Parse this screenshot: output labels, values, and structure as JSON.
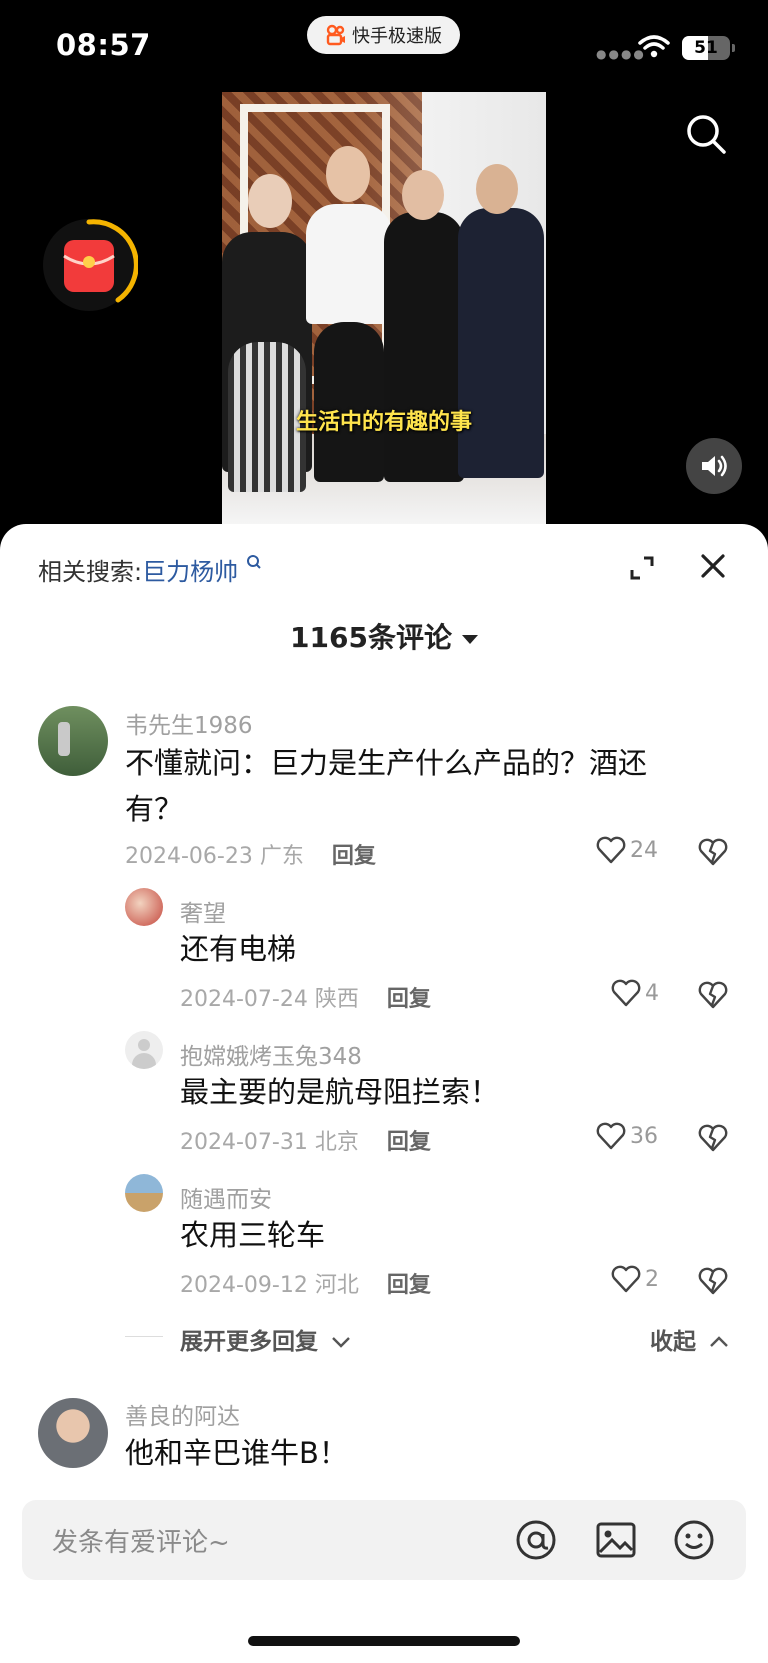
{
  "status_bar": {
    "time": "08:57",
    "app_name": "快手极速版",
    "battery": "51"
  },
  "video": {
    "caption": "生活中的有趣的事"
  },
  "panel": {
    "related_label": "相关搜索:",
    "related_keyword": "巨力杨帅",
    "comment_count": "1165条评论"
  },
  "comments": [
    {
      "user": "韦先生1986",
      "text_line1": "不懂就问：巨力是生产什么产品的？酒还",
      "text_line2": "有？",
      "date": "2024-06-23 广东",
      "reply": "回复",
      "likes": "24"
    },
    {
      "user": "奢望",
      "text": "还有电梯",
      "date": "2024-07-24 陕西",
      "reply": "回复",
      "likes": "4"
    },
    {
      "user": "抱嫦娥烤玉兔348",
      "text": "最主要的是航母阻拦索！",
      "date": "2024-07-31 北京",
      "reply": "回复",
      "likes": "36"
    },
    {
      "user": "随遇而安",
      "text": "农用三轮车",
      "date": "2024-09-12 河北",
      "reply": "回复",
      "likes": "2"
    },
    {
      "user": "善良的阿达",
      "text": "他和辛巴谁牛B！"
    }
  ],
  "replies_controls": {
    "expand": "展开更多回复",
    "collapse": "收起"
  },
  "input": {
    "placeholder": "发条有爱评论~"
  },
  "colors": {
    "accent_link": "#2d5aa0",
    "caption_yellow": "#ffe44d",
    "redpacket": "#f23b3b"
  }
}
